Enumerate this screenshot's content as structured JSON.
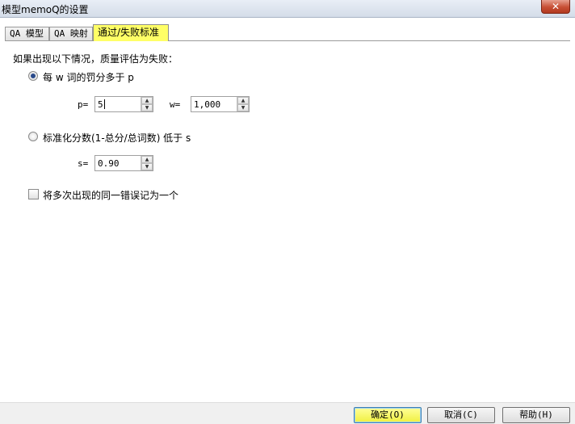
{
  "window": {
    "title": "模型memoQ的设置",
    "close_label": "✕"
  },
  "tabs": [
    {
      "label": "QA 模型",
      "active": false
    },
    {
      "label": "QA 映射",
      "active": false
    },
    {
      "label": "通过/失败标准",
      "active": true
    }
  ],
  "content": {
    "heading": "如果出现以下情况，质量评估为失败：",
    "option1": {
      "label": "每 w 词的罚分多于 p",
      "selected": true,
      "p_label": "p=",
      "p_value": "5",
      "w_label": "w=",
      "w_value": "1,000"
    },
    "option2": {
      "label": "标准化分数(1-总分/总词数) 低于 s",
      "selected": false,
      "s_label": "s=",
      "s_value": "0.90"
    },
    "checkbox": {
      "label": "将多次出现的同一错误记为一个",
      "checked": false
    }
  },
  "spinner": {
    "up_glyph": "▲",
    "down_glyph": "▼"
  },
  "buttons": {
    "ok": "确定(O)",
    "cancel": "取消(C)",
    "help": "帮助(H)"
  },
  "colors": {
    "active_tab": "#ffff66",
    "ok_button": "#f0f040"
  }
}
